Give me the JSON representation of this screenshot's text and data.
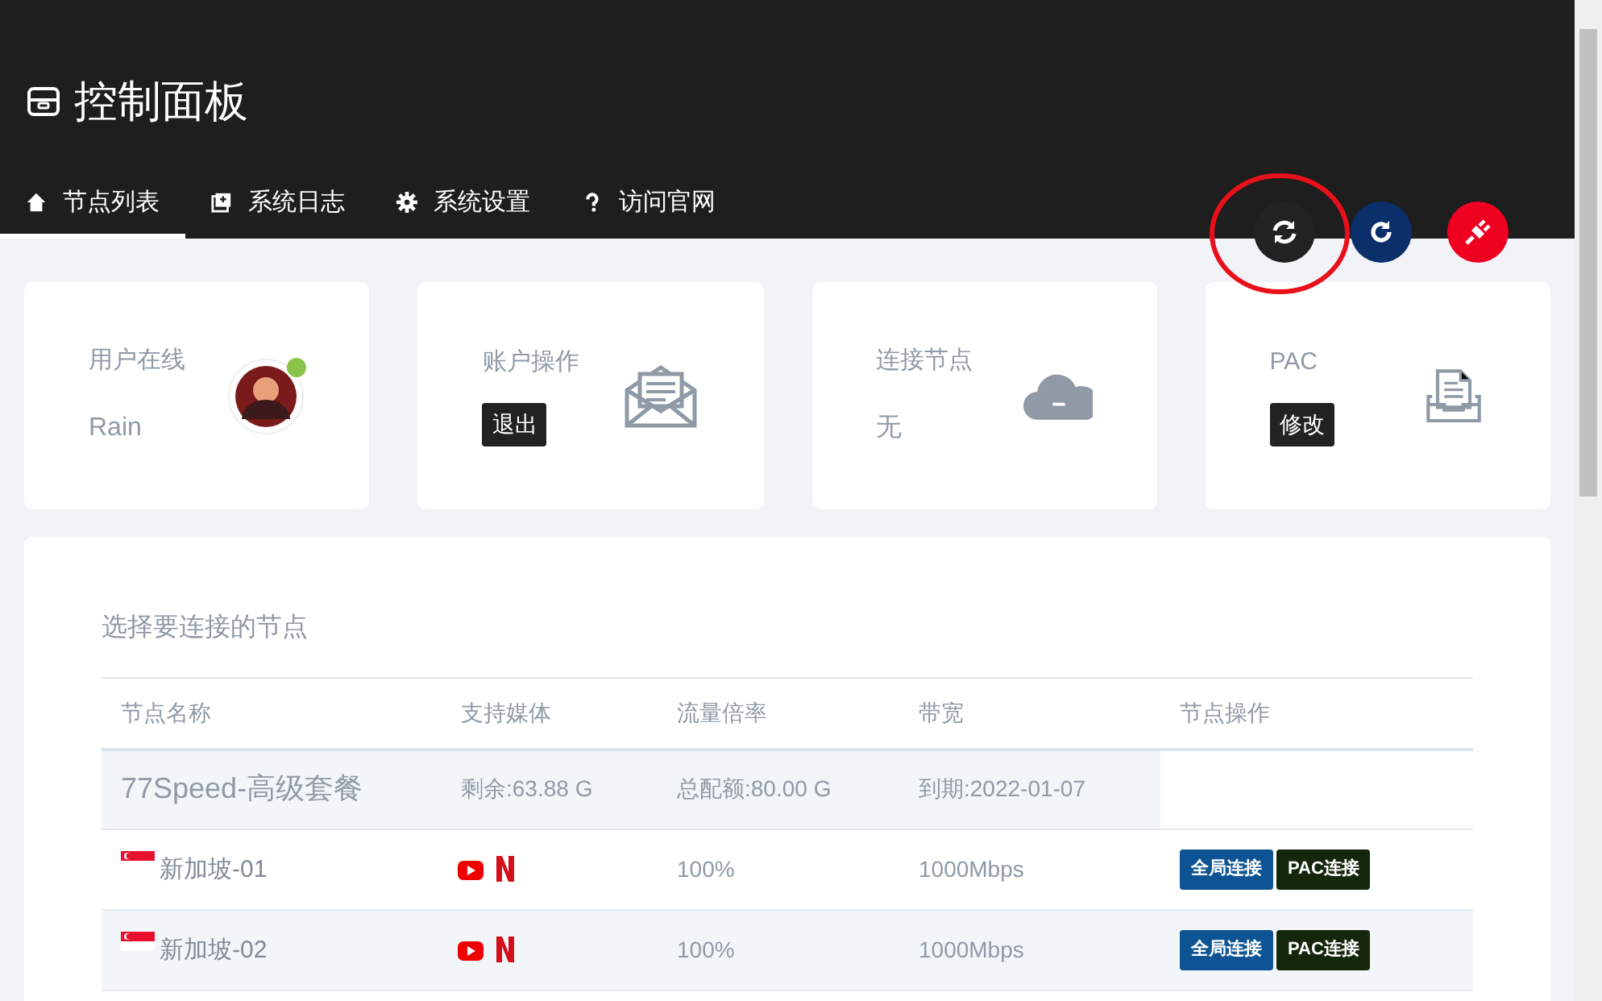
{
  "header": {
    "title": "控制面板"
  },
  "tabs": [
    {
      "label": "节点列表",
      "selected": true
    },
    {
      "label": "系统日志",
      "selected": false
    },
    {
      "label": "系统设置",
      "selected": false
    },
    {
      "label": "访问官网",
      "selected": false
    }
  ],
  "action_buttons": [
    {
      "kind": "sync",
      "highlighted": true
    },
    {
      "kind": "refresh",
      "highlighted": false
    },
    {
      "kind": "plug",
      "highlighted": false
    }
  ],
  "stat_cards": [
    {
      "kind": "user",
      "label": "用户在线",
      "value": "Rain",
      "online": true
    },
    {
      "kind": "account",
      "label": "账户操作",
      "button": "退出"
    },
    {
      "kind": "node",
      "label": "连接节点",
      "value": "无"
    },
    {
      "kind": "pac",
      "label": "PAC",
      "button": "修改"
    }
  ],
  "node_table": {
    "title": "选择要连接的节点",
    "columns": [
      "节点名称",
      "支持媒体",
      "流量倍率",
      "带宽",
      "节点操作"
    ],
    "plan_row": {
      "name": "77Speed-高级套餐",
      "remaining": "剩余:63.88 G",
      "quota": "总配额:80.00 G",
      "expiry": "到期:2022-01-07"
    },
    "rows": [
      {
        "name": "新加坡-01",
        "media": [
          {
            "kind": "youtube"
          },
          {
            "kind": "netflix"
          }
        ],
        "rate": "100%",
        "bandwidth": "1000Mbps",
        "buttons": [
          {
            "label": "全局连接",
            "kind": "global"
          },
          {
            "label": "PAC连接",
            "kind": "pac"
          }
        ]
      },
      {
        "name": "新加坡-02",
        "media": [
          {
            "kind": "youtube"
          },
          {
            "kind": "netflix"
          }
        ],
        "rate": "100%",
        "bandwidth": "1000Mbps",
        "buttons": [
          {
            "label": "全局连接",
            "kind": "global"
          },
          {
            "label": "PAC连接",
            "kind": "pac"
          }
        ]
      }
    ]
  }
}
